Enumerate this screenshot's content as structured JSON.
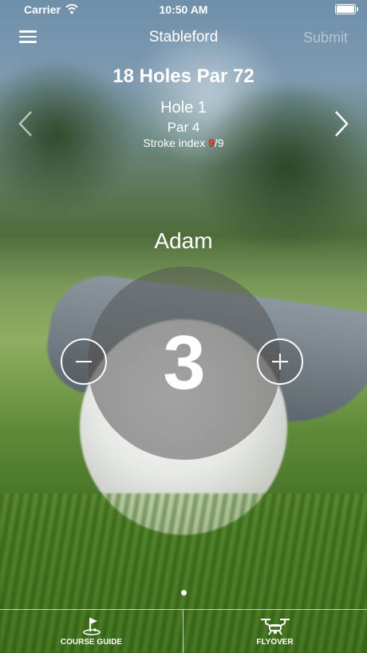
{
  "status_bar": {
    "carrier": "Carrier",
    "time": "10:50 AM"
  },
  "nav": {
    "title": "Stableford",
    "submit_label": "Submit",
    "menu_icon": "hamburger-menu-icon"
  },
  "round": {
    "course": "18 Holes Par 72",
    "hole": "Hole 1",
    "par": "Par 4",
    "stroke_index_label": "Stroke index ",
    "stroke_index_current": "9",
    "stroke_index_total": "/9"
  },
  "player": {
    "name": "Adam",
    "score": "3"
  },
  "pager": {
    "pages": 1,
    "current": 1
  },
  "tabs": [
    {
      "label": "COURSE GUIDE",
      "icon": "golf-flag-icon"
    },
    {
      "label": "FLYOVER",
      "icon": "drone-icon"
    }
  ],
  "colors": {
    "stroke_index_highlight": "#e0201c",
    "score_circle": "#555555"
  }
}
